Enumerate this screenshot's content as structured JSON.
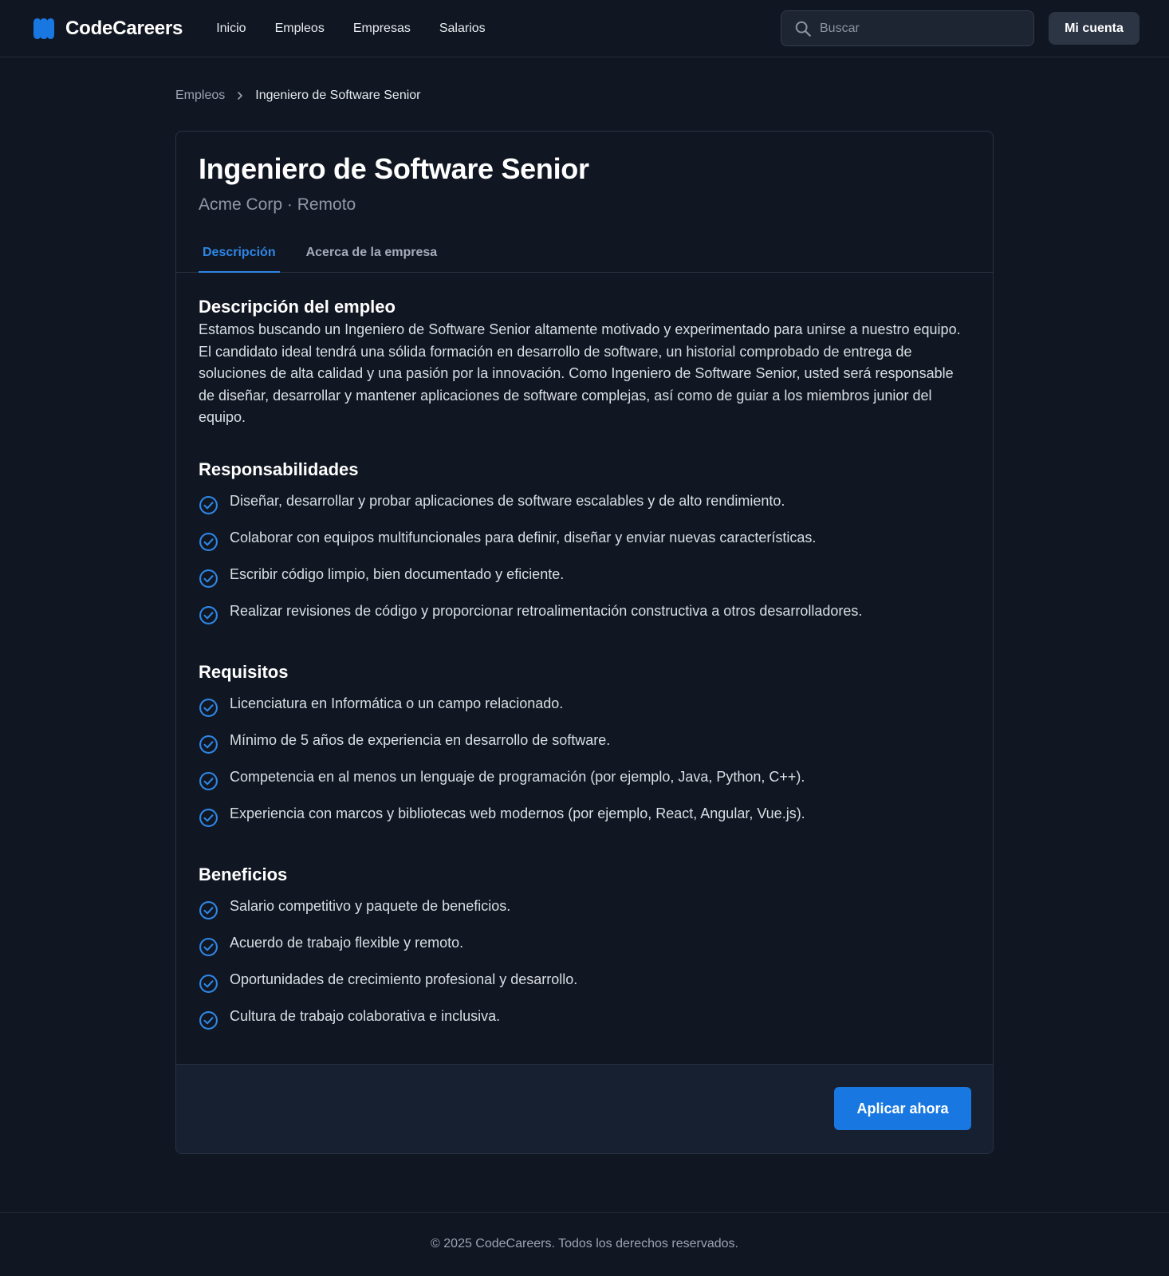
{
  "header": {
    "brand": "CodeCareers",
    "brand_color": "#1877e0",
    "nav": [
      "Inicio",
      "Empleos",
      "Empresas",
      "Salarios"
    ],
    "search_placeholder": "Buscar",
    "account_label": "Mi cuenta"
  },
  "breadcrumb": {
    "parent": "Empleos",
    "current": "Ingeniero de Software Senior"
  },
  "job": {
    "title": "Ingeniero de Software Senior",
    "subtitle": "Acme Corp · Remoto",
    "tabs": [
      "Descripción",
      "Acerca de la empresa"
    ],
    "active_tab": "Descripción",
    "description_title": "Descripción del empleo",
    "description": "Estamos buscando un Ingeniero de Software Senior altamente motivado y experimentado para unirse a nuestro equipo. El candidato ideal tendrá una sólida formación en desarrollo de software, un historial comprobado de entrega de soluciones de alta calidad y una pasión por la innovación. Como Ingeniero de Software Senior, usted será responsable de diseñar, desarrollar y mantener aplicaciones de software complejas, así como de guiar a los miembros junior del equipo.",
    "responsibilities_title": "Responsabilidades",
    "responsibilities": [
      "Diseñar, desarrollar y probar aplicaciones de software escalables y de alto rendimiento.",
      "Colaborar con equipos multifuncionales para definir, diseñar y enviar nuevas características.",
      "Escribir código limpio, bien documentado y eficiente.",
      "Realizar revisiones de código y proporcionar retroalimentación constructiva a otros desarrolladores."
    ],
    "requirements_title": "Requisitos",
    "requirements": [
      "Licenciatura en Informática o un campo relacionado.",
      "Mínimo de 5 años de experiencia en desarrollo de software.",
      "Competencia en al menos un lenguaje de programación (por ejemplo, Java, Python, C++).",
      "Experiencia con marcos y bibliotecas web modernos (por ejemplo, React, Angular, Vue.js)."
    ],
    "benefits_title": "Beneficios",
    "benefits": [
      "Salario competitivo y paquete de beneficios.",
      "Acuerdo de trabajo flexible y remoto.",
      "Oportunidades de crecimiento profesional y desarrollo.",
      "Cultura de trabajo colaborativa e inclusiva."
    ],
    "apply_label": "Aplicar ahora"
  },
  "footer": {
    "copyright": "© 2025 CodeCareers. Todos los derechos reservados."
  },
  "icons": {
    "logo": "codecareers-logo-icon",
    "search": "search-icon",
    "breadcrumb_separator": "chevron-right-icon",
    "list_bullet": "check-circle-icon"
  }
}
